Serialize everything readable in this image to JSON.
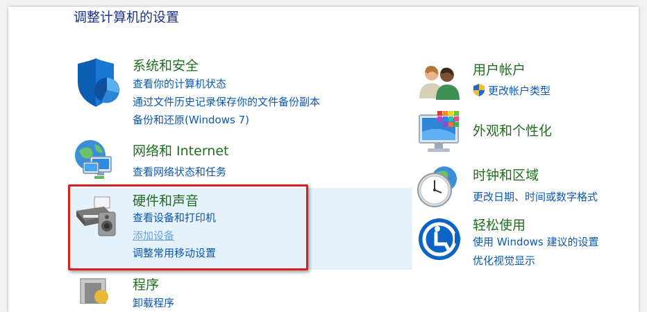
{
  "page": {
    "title": "调整计算机的设置"
  },
  "left_categories": [
    {
      "title": "系统和安全",
      "icon": "security-shield-icon",
      "links": [
        "查看你的计算机状态",
        "通过文件历史记录保存你的文件备份副本",
        "备份和还原(Windows 7)"
      ]
    },
    {
      "title": "网络和 Internet",
      "icon": "network-globe-icon",
      "links": [
        "查看网络状态和任务"
      ]
    },
    {
      "title": "硬件和声音",
      "icon": "printer-speaker-icon",
      "links": [
        "查看设备和打印机",
        "添加设备",
        "调整常用移动设置"
      ]
    },
    {
      "title": "程序",
      "icon": "programs-icon",
      "links": [
        "卸载程序"
      ]
    }
  ],
  "right_categories": [
    {
      "title": "用户帐户",
      "icon": "users-icon",
      "links": [
        "更改帐户类型"
      ]
    },
    {
      "title": "外观和个性化",
      "icon": "monitor-palette-icon",
      "links": []
    },
    {
      "title": "时钟和区域",
      "icon": "clock-globe-icon",
      "links": [
        "更改日期、时间或数字格式"
      ]
    },
    {
      "title": "轻松使用",
      "icon": "ease-of-access-icon",
      "links": [
        "使用 Windows 建议的设置",
        "优化视觉显示"
      ]
    }
  ],
  "colors": {
    "title_green": "#1e6e1e",
    "link_blue": "#0a58b5",
    "hover_link": "#6aa6df",
    "hover_background": "#e5f1fb",
    "highlight_red": "#d6201f"
  }
}
